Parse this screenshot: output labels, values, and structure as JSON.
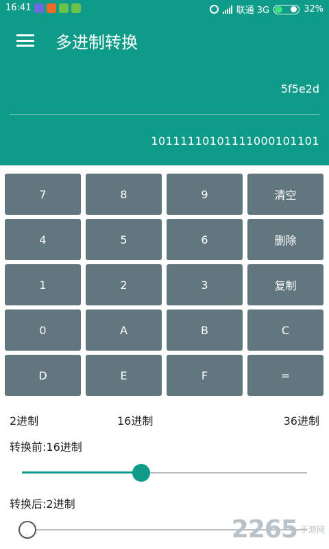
{
  "status_bar": {
    "time": "16:41",
    "carrier": "联通 3G",
    "battery": "32%",
    "battery_level": 0.32,
    "notification_icons": [
      "app-icon-purple",
      "app-icon-orange",
      "app-icon-green",
      "app-icon-green"
    ],
    "notification_colors": [
      "#6b6bd9",
      "#f06a27",
      "#6cc24a",
      "#6cc24a"
    ]
  },
  "app_bar": {
    "title": "多进制转换",
    "menu_icon": "hamburger-menu-icon"
  },
  "display": {
    "input_value": "5f5e2d",
    "output_value": "10111110101111000101101"
  },
  "keypad": {
    "keys": [
      "7",
      "8",
      "9",
      "清空",
      "4",
      "5",
      "6",
      "删除",
      "1",
      "2",
      "3",
      "复制",
      "0",
      "A",
      "B",
      "C",
      "D",
      "E",
      "F",
      "="
    ]
  },
  "base_options": {
    "left": "2进制",
    "middle": "16进制",
    "right": "36进制"
  },
  "before": {
    "label": "转换前:16进制",
    "slider_value": 16
  },
  "after": {
    "label": "转换后:2进制",
    "slider_value": 2
  },
  "slider_range": [
    2,
    36
  ],
  "colors": {
    "primary": "#0f9b8a",
    "key_background": "#62767f"
  },
  "watermark": {
    "logo": "2265",
    "site": "手游网"
  }
}
